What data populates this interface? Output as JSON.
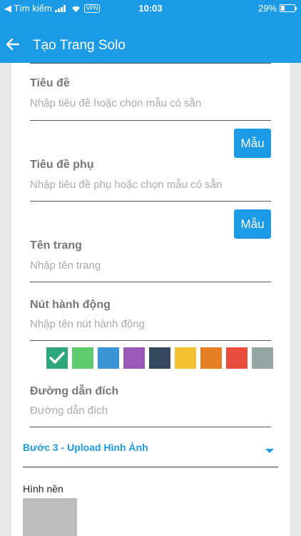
{
  "status_bar": {
    "carrier": "◀ Tìm kiếm",
    "vpn": "VPN",
    "time": "10:03",
    "battery": "29%",
    "battery_level": 0.29
  },
  "app_bar": {
    "title": "Tạo Trang Solo"
  },
  "form": {
    "title": {
      "label": "Tiêu đề",
      "placeholder": "Nhập tiêu đề hoặc chọn mẫu có sẵn"
    },
    "title_template_button": "Mẫu",
    "subtitle": {
      "label": "Tiêu đề phụ",
      "placeholder": "Nhập tiêu đề phụ hoặc chọn mẫu có sẵn"
    },
    "subtitle_template_button": "Mẫu",
    "page_name": {
      "label": "Tên trang",
      "placeholder": "Nhập tên trang"
    },
    "action_button": {
      "label": "Nút hành động",
      "placeholder": "Nhập tên nút hành động"
    },
    "colors": [
      "#2ea87a",
      "#5dcc6b",
      "#3a94d6",
      "#9b59b6",
      "#34495e",
      "#f1c231",
      "#e67e22",
      "#e74c3c",
      "#95a5a6"
    ],
    "selected_color_index": 0,
    "destination": {
      "label": "Đường dẫn đích",
      "placeholder": "Đường dẫn đích"
    }
  },
  "step3": {
    "title": "Bước 3 - Upload Hình Ảnh"
  },
  "background": {
    "label": "Hình nền"
  }
}
